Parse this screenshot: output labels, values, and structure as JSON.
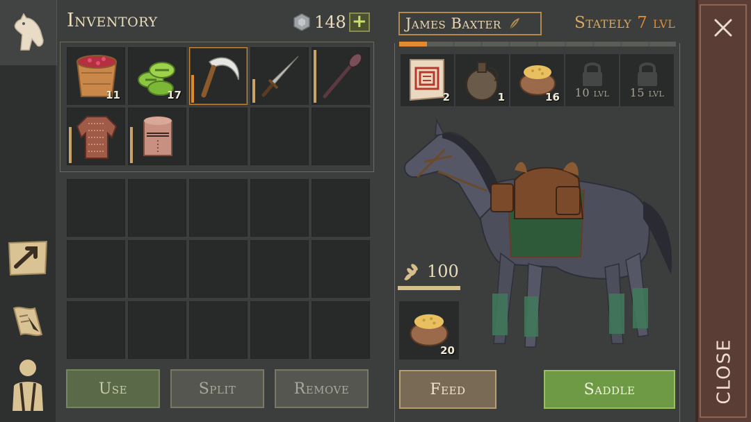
{
  "inventory": {
    "title": "Inventory",
    "currency_count": "148",
    "add_label": "+",
    "items": [
      {
        "name": "berry-bucket",
        "qty": "11"
      },
      {
        "name": "green-crop",
        "qty": "17"
      },
      {
        "name": "sickle",
        "qty": ""
      },
      {
        "name": "sword",
        "qty": ""
      },
      {
        "name": "mace",
        "qty": ""
      },
      {
        "name": "chainmail-shirt",
        "qty": ""
      },
      {
        "name": "knight-helmet",
        "qty": ""
      }
    ]
  },
  "actions": {
    "use": "Use",
    "split": "Split",
    "remove": "Remove"
  },
  "horse": {
    "name": "James Baxter",
    "rank_label": "Stately",
    "level": "7",
    "level_unit": "lvl",
    "xp_progress": 0.1,
    "slots": [
      {
        "name": "scroll",
        "qty": "2"
      },
      {
        "name": "flask",
        "qty": "1"
      },
      {
        "name": "feed-sack",
        "qty": "16"
      },
      {
        "name": "locked-slot",
        "unlock": "10 lvl"
      },
      {
        "name": "locked-slot",
        "unlock": "15 lvl"
      }
    ],
    "satiety": "100",
    "feed_item_qty": "20"
  },
  "buttons": {
    "feed": "Feed",
    "saddle": "Saddle",
    "close": "CLOSE"
  },
  "colors": {
    "accent_orange": "#e48a30",
    "saddle_green": "#6f9a45",
    "close_panel": "#5a3e35"
  }
}
